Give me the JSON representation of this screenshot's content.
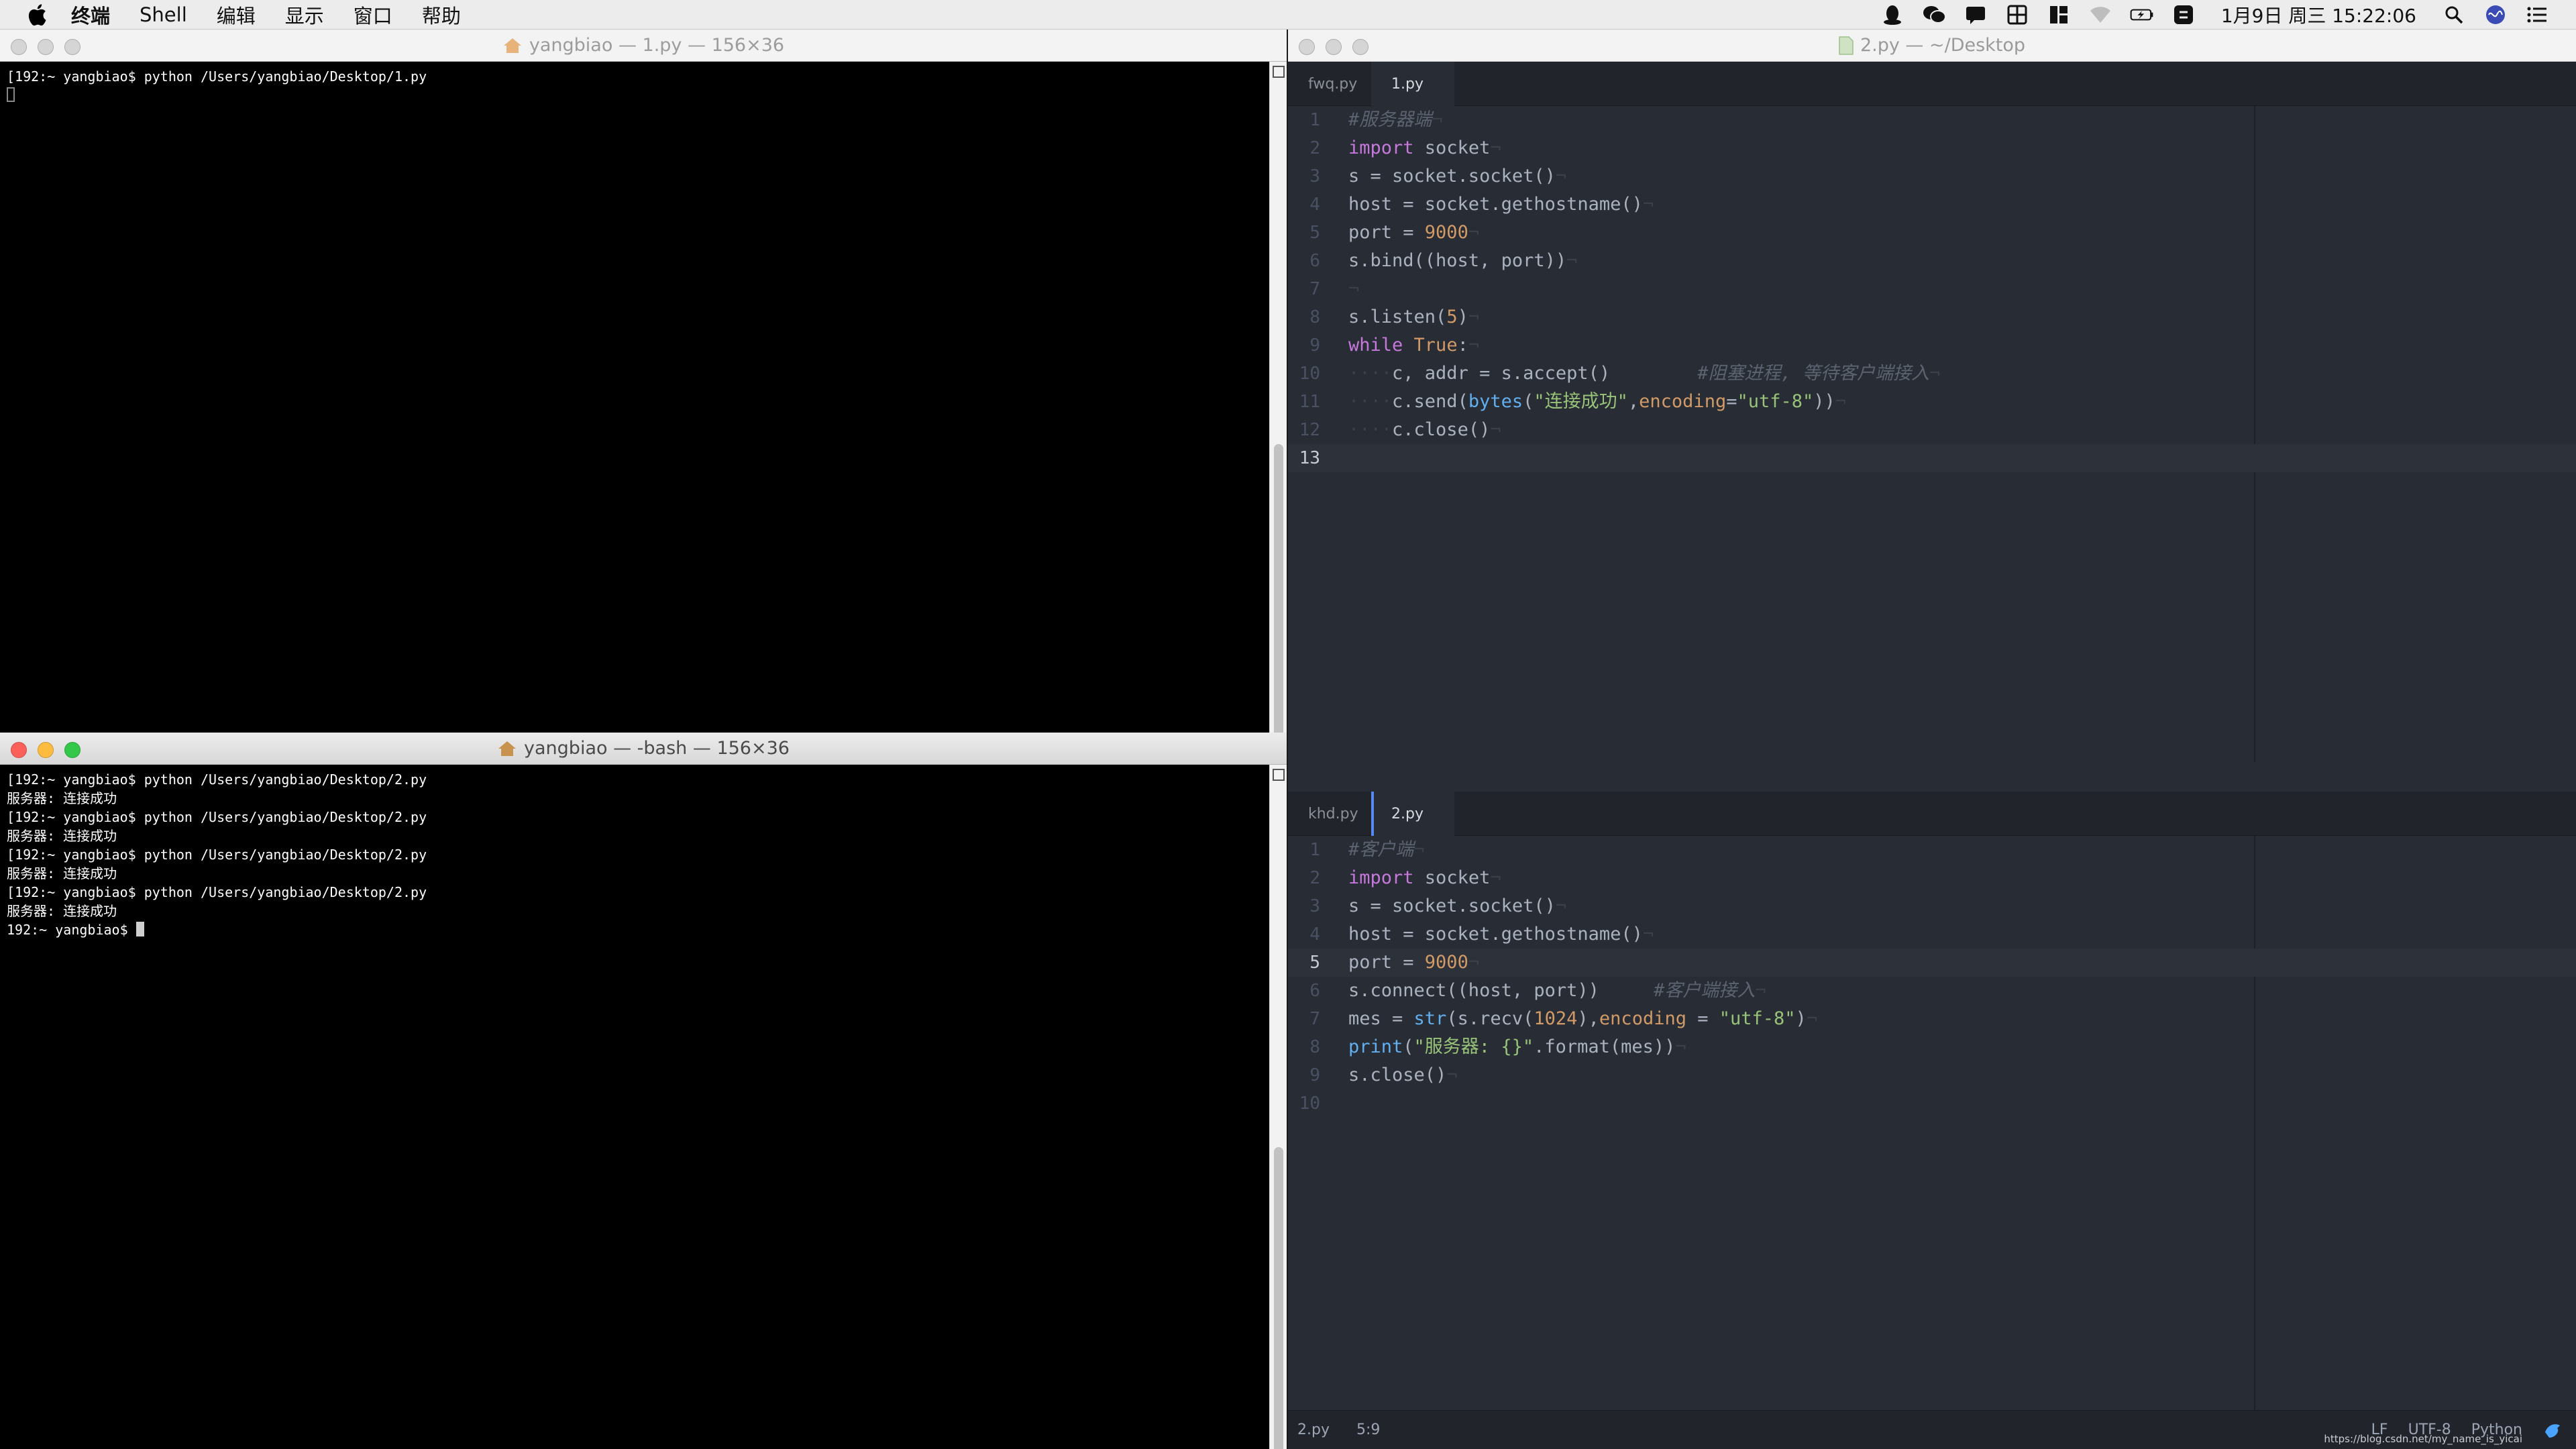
{
  "menubar": {
    "app_name": "终端",
    "menus": [
      "Shell",
      "编辑",
      "显示",
      "窗口",
      "帮助"
    ],
    "clock": "1月9日 周三  15:22:06"
  },
  "terminal_top": {
    "title": "yangbiao — 1.py — 156×36",
    "lines": [
      "[192:~ yangbiao$ python /Users/yangbiao/Desktop/1.py"
    ]
  },
  "terminal_bottom": {
    "title": "yangbiao — -bash — 156×36",
    "lines": [
      "[192:~ yangbiao$ python /Users/yangbiao/Desktop/2.py",
      "服务器: 连接成功",
      "[192:~ yangbiao$ python /Users/yangbiao/Desktop/2.py",
      "服务器: 连接成功",
      "[192:~ yangbiao$ python /Users/yangbiao/Desktop/2.py",
      "服务器: 连接成功",
      "[192:~ yangbiao$ python /Users/yangbiao/Desktop/2.py",
      "服务器: 连接成功"
    ],
    "prompt": "192:~ yangbiao$ "
  },
  "editor": {
    "title": "2.py — ~/Desktop",
    "top_pane": {
      "tabs": [
        "fwq.py",
        "1.py"
      ],
      "active_tab": 1,
      "current_line": 13,
      "code": [
        [
          [
            "cm",
            "#服务器端"
          ],
          [
            "inv",
            "¬"
          ]
        ],
        [
          [
            "kw",
            "import"
          ],
          [
            "",
            " socket"
          ],
          [
            "inv",
            "¬"
          ]
        ],
        [
          [
            "",
            "s = socket.socket()"
          ],
          [
            "inv",
            "¬"
          ]
        ],
        [
          [
            "",
            "host = socket.gethostname()"
          ],
          [
            "inv",
            "¬"
          ]
        ],
        [
          [
            "",
            "port = "
          ],
          [
            "num",
            "9000"
          ],
          [
            "inv",
            "¬"
          ]
        ],
        [
          [
            "",
            "s.bind((host, port))"
          ],
          [
            "inv",
            "¬"
          ]
        ],
        [
          [
            "inv",
            "¬"
          ]
        ],
        [
          [
            "",
            "s.listen("
          ],
          [
            "num",
            "5"
          ],
          [
            "",
            ")"
          ],
          [
            "inv",
            "¬"
          ]
        ],
        [
          [
            "kw",
            "while"
          ],
          [
            "",
            " "
          ],
          [
            "num",
            "True"
          ],
          [
            "",
            ":"
          ],
          [
            "inv",
            "¬"
          ]
        ],
        [
          [
            "inv",
            "····"
          ],
          [
            "",
            "c, addr = s.accept()        "
          ],
          [
            "cm",
            "#阻塞进程, 等待客户端接入"
          ],
          [
            "inv",
            "¬"
          ]
        ],
        [
          [
            "inv",
            "····"
          ],
          [
            "",
            "c.send("
          ],
          [
            "fn",
            "bytes"
          ],
          [
            "",
            "("
          ],
          [
            "str",
            "\"连接成功\""
          ],
          [
            "",
            ","
          ],
          [
            "num",
            "encoding"
          ],
          [
            "",
            "="
          ],
          [
            "str",
            "\"utf-8\""
          ],
          [
            "",
            "))"
          ],
          [
            "inv",
            "¬"
          ]
        ],
        [
          [
            "inv",
            "····"
          ],
          [
            "",
            "c.close()"
          ],
          [
            "inv",
            "¬"
          ]
        ],
        []
      ]
    },
    "bottom_pane": {
      "tabs": [
        "khd.py",
        "2.py"
      ],
      "active_tab": 1,
      "current_line": 5,
      "code": [
        [
          [
            "cm",
            "#客户端"
          ],
          [
            "inv",
            "¬"
          ]
        ],
        [
          [
            "kw",
            "import"
          ],
          [
            "",
            " socket"
          ],
          [
            "inv",
            "¬"
          ]
        ],
        [
          [
            "",
            "s = socket.socket()"
          ],
          [
            "inv",
            "¬"
          ]
        ],
        [
          [
            "",
            "host = socket.gethostname()"
          ],
          [
            "inv",
            "¬"
          ]
        ],
        [
          [
            "",
            "port = "
          ],
          [
            "num",
            "9000"
          ],
          [
            "inv",
            "¬"
          ]
        ],
        [
          [
            "",
            "s.connect((host, port))     "
          ],
          [
            "cm",
            "#客户端接入"
          ],
          [
            "inv",
            "¬"
          ]
        ],
        [
          [
            "",
            "mes = "
          ],
          [
            "fn",
            "str"
          ],
          [
            "",
            "(s.recv("
          ],
          [
            "num",
            "1024"
          ],
          [
            "",
            "),"
          ],
          [
            "num",
            "encoding"
          ],
          [
            "",
            " = "
          ],
          [
            "str",
            "\"utf-8\""
          ],
          [
            "",
            ")"
          ],
          [
            "inv",
            "¬"
          ]
        ],
        [
          [
            "fn",
            "print"
          ],
          [
            "",
            "("
          ],
          [
            "str",
            "\"服务器: {}\""
          ],
          [
            "",
            ".format(mes))"
          ],
          [
            "inv",
            "¬"
          ]
        ],
        [
          [
            "",
            "s.close()"
          ],
          [
            "inv",
            "¬"
          ]
        ],
        []
      ]
    },
    "status": {
      "file": "2.py",
      "cursor": "5:9",
      "line_ending": "LF",
      "encoding": "UTF-8",
      "grammar": "Python",
      "watermark": "https://blog.csdn.net/my_name_is_yicai"
    }
  },
  "colors": {
    "close": "#fc605b",
    "minimize": "#fdbc40",
    "zoom": "#34c84a"
  }
}
